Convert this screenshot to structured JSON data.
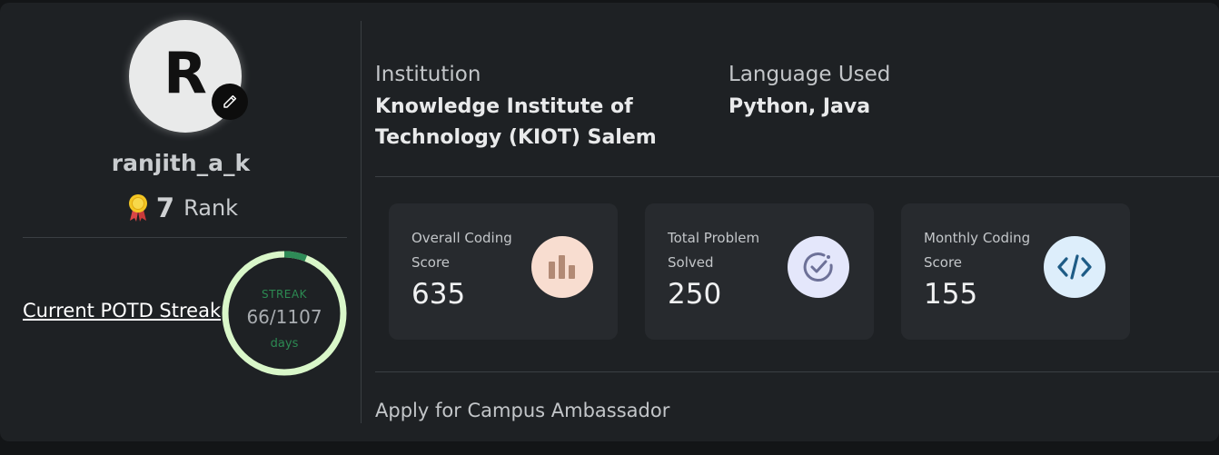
{
  "profile": {
    "avatar_initial": "R",
    "username": "ranjith_a_k",
    "rank_value": "7",
    "rank_label": "Rank"
  },
  "potd": {
    "link_label": "Current POTD Streak",
    "streak_label": "STREAK",
    "streak_value": "66/1107",
    "streak_current": 66,
    "streak_total": 1107,
    "days_label": "days",
    "ring_color": "#d9f7c9",
    "progress_color": "#2e8b57"
  },
  "info": {
    "institution_label": "Institution",
    "institution_value_line1": "Knowledge Institute of",
    "institution_value_line2": "Technology (KIOT) Salem",
    "language_label": "Language Used",
    "language_value": "Python, Java"
  },
  "stats": [
    {
      "label_line1": "Overall Coding",
      "label_line2": "Score",
      "value": "635",
      "icon": "bar-chart-icon",
      "icon_bg": "#f8ddd0",
      "icon_color": "#b28a75"
    },
    {
      "label_line1": "Total Problem",
      "label_line2": "Solved",
      "value": "250",
      "icon": "check-circle-icon",
      "icon_bg": "#e4e7fb",
      "icon_color": "#6d7198"
    },
    {
      "label_line1": "Monthly Coding",
      "label_line2": "Score",
      "value": "155",
      "icon": "code-icon",
      "icon_bg": "#ddeefb",
      "icon_color": "#1e5c86"
    }
  ],
  "campus": {
    "apply_label": "Apply for Campus Ambassador"
  }
}
